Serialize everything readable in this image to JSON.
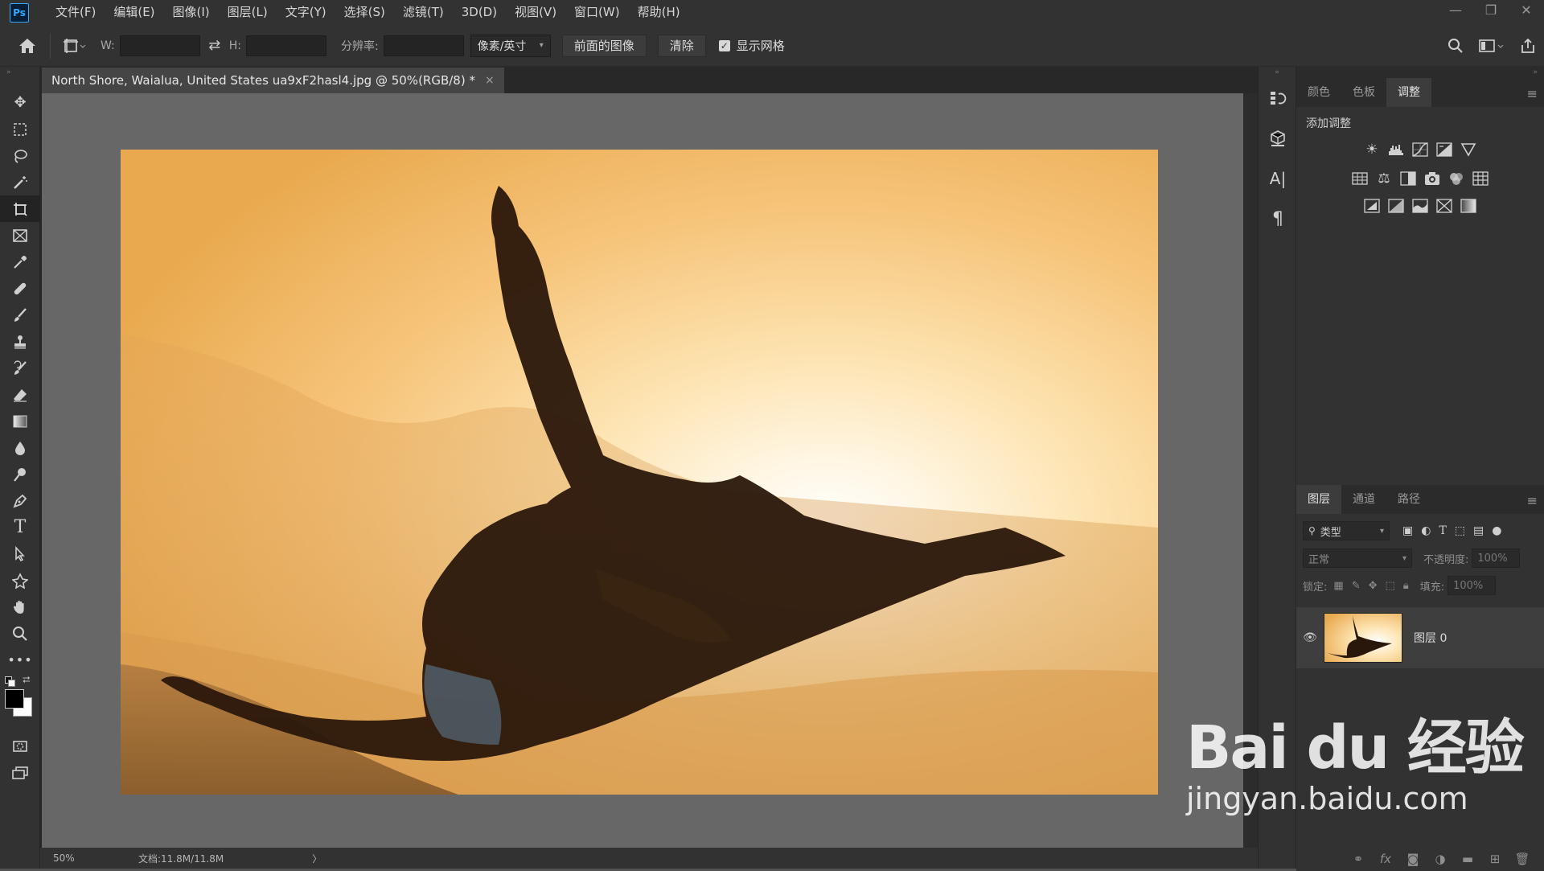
{
  "app": {
    "logo": "Ps"
  },
  "menu": [
    "文件(F)",
    "编辑(E)",
    "图像(I)",
    "图层(L)",
    "文字(Y)",
    "选择(S)",
    "滤镜(T)",
    "3D(D)",
    "视图(V)",
    "窗口(W)",
    "帮助(H)"
  ],
  "window_controls": {
    "minimize": "—",
    "restore": "❐",
    "close": "✕"
  },
  "options": {
    "w_label": "W:",
    "h_label": "H:",
    "resolution_label": "分辨率:",
    "unit_select": "像素/英寸",
    "front_image_button": "前面的图像",
    "clear_button": "清除",
    "show_grid_label": "显示网格",
    "show_grid_checked": true
  },
  "document": {
    "tab_title": "North Shore, Waialua, United States ua9xF2hasl4.jpg @ 50%(RGB/8) *",
    "close": "×"
  },
  "status": {
    "zoom": "50%",
    "doc_info": "文档:11.8M/11.8M",
    "arrow": "〉"
  },
  "panels": {
    "top_tabs": [
      "颜色",
      "色板",
      "调整"
    ],
    "top_active": "调整",
    "adjust_title": "添加调整",
    "adjust_rows": [
      [
        "brightness-icon",
        "levels-icon",
        "curves-icon",
        "exposure-icon",
        "vibrance-icon"
      ],
      [
        "hue-saturation-icon",
        "color-balance-icon",
        "black-white-icon",
        "photo-filter-icon",
        "channel-mixer-icon",
        "color-lookup-icon"
      ],
      [
        "invert-icon",
        "posterize-icon",
        "threshold-icon",
        "selective-color-icon",
        "gradient-map-icon"
      ]
    ],
    "layers_tabs": [
      "图层",
      "通道",
      "路径"
    ],
    "layers_active": "图层",
    "filter_type": "类型",
    "blend_mode": "正常",
    "opacity_label": "不透明度:",
    "opacity_value": "100%",
    "lock_label": "锁定:",
    "fill_label": "填充:",
    "fill_value": "100%",
    "layer_name": "图层 0"
  },
  "watermark": {
    "logo": "Bai du 经验",
    "url": "jingyan.baidu.com"
  },
  "colors": {
    "accent_ps": "#31a8ff",
    "bg_panel": "#323232",
    "bg_dark": "#282828",
    "pasteboard": "#676767"
  }
}
